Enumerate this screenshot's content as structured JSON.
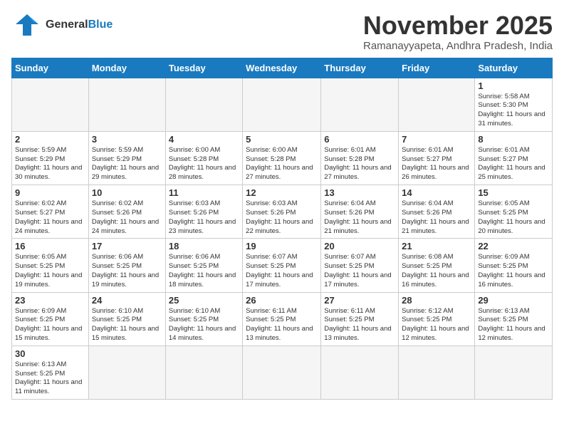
{
  "header": {
    "logo_general": "General",
    "logo_blue": "Blue",
    "month_title": "November 2025",
    "location": "Ramanayyapeta, Andhra Pradesh, India"
  },
  "weekdays": [
    "Sunday",
    "Monday",
    "Tuesday",
    "Wednesday",
    "Thursday",
    "Friday",
    "Saturday"
  ],
  "weeks": [
    [
      {
        "day": "",
        "empty": true
      },
      {
        "day": "",
        "empty": true
      },
      {
        "day": "",
        "empty": true
      },
      {
        "day": "",
        "empty": true
      },
      {
        "day": "",
        "empty": true
      },
      {
        "day": "",
        "empty": true
      },
      {
        "day": "1",
        "sunrise": "5:58 AM",
        "sunset": "5:30 PM",
        "daylight": "11 hours and 31 minutes."
      }
    ],
    [
      {
        "day": "2",
        "sunrise": "5:59 AM",
        "sunset": "5:29 PM",
        "daylight": "11 hours and 30 minutes."
      },
      {
        "day": "3",
        "sunrise": "5:59 AM",
        "sunset": "5:29 PM",
        "daylight": "11 hours and 29 minutes."
      },
      {
        "day": "4",
        "sunrise": "6:00 AM",
        "sunset": "5:28 PM",
        "daylight": "11 hours and 28 minutes."
      },
      {
        "day": "5",
        "sunrise": "6:00 AM",
        "sunset": "5:28 PM",
        "daylight": "11 hours and 27 minutes."
      },
      {
        "day": "6",
        "sunrise": "6:01 AM",
        "sunset": "5:28 PM",
        "daylight": "11 hours and 27 minutes."
      },
      {
        "day": "7",
        "sunrise": "6:01 AM",
        "sunset": "5:27 PM",
        "daylight": "11 hours and 26 minutes."
      },
      {
        "day": "8",
        "sunrise": "6:01 AM",
        "sunset": "5:27 PM",
        "daylight": "11 hours and 25 minutes."
      }
    ],
    [
      {
        "day": "9",
        "sunrise": "6:02 AM",
        "sunset": "5:27 PM",
        "daylight": "11 hours and 24 minutes."
      },
      {
        "day": "10",
        "sunrise": "6:02 AM",
        "sunset": "5:26 PM",
        "daylight": "11 hours and 24 minutes."
      },
      {
        "day": "11",
        "sunrise": "6:03 AM",
        "sunset": "5:26 PM",
        "daylight": "11 hours and 23 minutes."
      },
      {
        "day": "12",
        "sunrise": "6:03 AM",
        "sunset": "5:26 PM",
        "daylight": "11 hours and 22 minutes."
      },
      {
        "day": "13",
        "sunrise": "6:04 AM",
        "sunset": "5:26 PM",
        "daylight": "11 hours and 21 minutes."
      },
      {
        "day": "14",
        "sunrise": "6:04 AM",
        "sunset": "5:26 PM",
        "daylight": "11 hours and 21 minutes."
      },
      {
        "day": "15",
        "sunrise": "6:05 AM",
        "sunset": "5:25 PM",
        "daylight": "11 hours and 20 minutes."
      }
    ],
    [
      {
        "day": "16",
        "sunrise": "6:05 AM",
        "sunset": "5:25 PM",
        "daylight": "11 hours and 19 minutes."
      },
      {
        "day": "17",
        "sunrise": "6:06 AM",
        "sunset": "5:25 PM",
        "daylight": "11 hours and 19 minutes."
      },
      {
        "day": "18",
        "sunrise": "6:06 AM",
        "sunset": "5:25 PM",
        "daylight": "11 hours and 18 minutes."
      },
      {
        "day": "19",
        "sunrise": "6:07 AM",
        "sunset": "5:25 PM",
        "daylight": "11 hours and 17 minutes."
      },
      {
        "day": "20",
        "sunrise": "6:07 AM",
        "sunset": "5:25 PM",
        "daylight": "11 hours and 17 minutes."
      },
      {
        "day": "21",
        "sunrise": "6:08 AM",
        "sunset": "5:25 PM",
        "daylight": "11 hours and 16 minutes."
      },
      {
        "day": "22",
        "sunrise": "6:09 AM",
        "sunset": "5:25 PM",
        "daylight": "11 hours and 16 minutes."
      }
    ],
    [
      {
        "day": "23",
        "sunrise": "6:09 AM",
        "sunset": "5:25 PM",
        "daylight": "11 hours and 15 minutes."
      },
      {
        "day": "24",
        "sunrise": "6:10 AM",
        "sunset": "5:25 PM",
        "daylight": "11 hours and 15 minutes."
      },
      {
        "day": "25",
        "sunrise": "6:10 AM",
        "sunset": "5:25 PM",
        "daylight": "11 hours and 14 minutes."
      },
      {
        "day": "26",
        "sunrise": "6:11 AM",
        "sunset": "5:25 PM",
        "daylight": "11 hours and 13 minutes."
      },
      {
        "day": "27",
        "sunrise": "6:11 AM",
        "sunset": "5:25 PM",
        "daylight": "11 hours and 13 minutes."
      },
      {
        "day": "28",
        "sunrise": "6:12 AM",
        "sunset": "5:25 PM",
        "daylight": "11 hours and 12 minutes."
      },
      {
        "day": "29",
        "sunrise": "6:13 AM",
        "sunset": "5:25 PM",
        "daylight": "11 hours and 12 minutes."
      }
    ],
    [
      {
        "day": "30",
        "sunrise": "6:13 AM",
        "sunset": "5:25 PM",
        "daylight": "11 hours and 11 minutes."
      },
      {
        "day": "",
        "empty": true
      },
      {
        "day": "",
        "empty": true
      },
      {
        "day": "",
        "empty": true
      },
      {
        "day": "",
        "empty": true
      },
      {
        "day": "",
        "empty": true
      },
      {
        "day": "",
        "empty": true
      }
    ]
  ]
}
